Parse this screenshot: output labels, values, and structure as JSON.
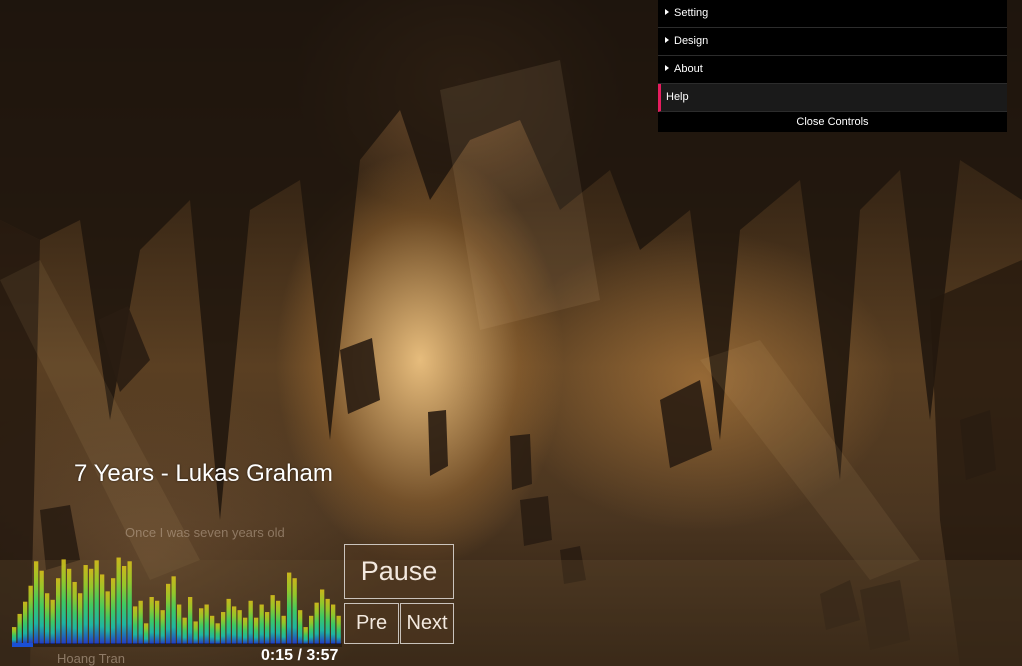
{
  "menu": {
    "items": [
      {
        "label": "Setting",
        "has_arrow": true
      },
      {
        "label": "Design",
        "has_arrow": true
      },
      {
        "label": "About",
        "has_arrow": true
      },
      {
        "label": "Help",
        "has_arrow": false,
        "active": true
      }
    ],
    "close_label": "Close Controls",
    "active_color": "#e61d5f"
  },
  "player": {
    "song_title": "7 Years - Lukas Graham",
    "lyric_line": "Once I was seven years old",
    "pause_label": "Pause",
    "pre_label": "Pre",
    "next_label": "Next",
    "time": "0:15 / 3:57",
    "progress": 0.063,
    "credit": "Hoang Tran",
    "progress_color": "#1a4fd6"
  },
  "visualizer": {
    "levels": [
      0.18,
      0.32,
      0.45,
      0.62,
      0.88,
      0.78,
      0.54,
      0.47,
      0.7,
      0.9,
      0.8,
      0.66,
      0.54,
      0.84,
      0.8,
      0.89,
      0.74,
      0.56,
      0.7,
      0.92,
      0.83,
      0.88,
      0.4,
      0.46,
      0.22,
      0.5,
      0.46,
      0.36,
      0.64,
      0.72,
      0.42,
      0.28,
      0.5,
      0.24,
      0.38,
      0.42,
      0.3,
      0.22,
      0.34,
      0.48,
      0.4,
      0.36,
      0.28,
      0.46,
      0.28,
      0.42,
      0.34,
      0.52,
      0.46,
      0.3,
      0.76,
      0.7,
      0.36,
      0.18,
      0.3,
      0.44,
      0.58,
      0.48,
      0.42,
      0.3
    ],
    "colors": [
      "#1e3bd8",
      "#19c2b0",
      "#3bd96a",
      "#9ad62b",
      "#d8c21a"
    ]
  }
}
